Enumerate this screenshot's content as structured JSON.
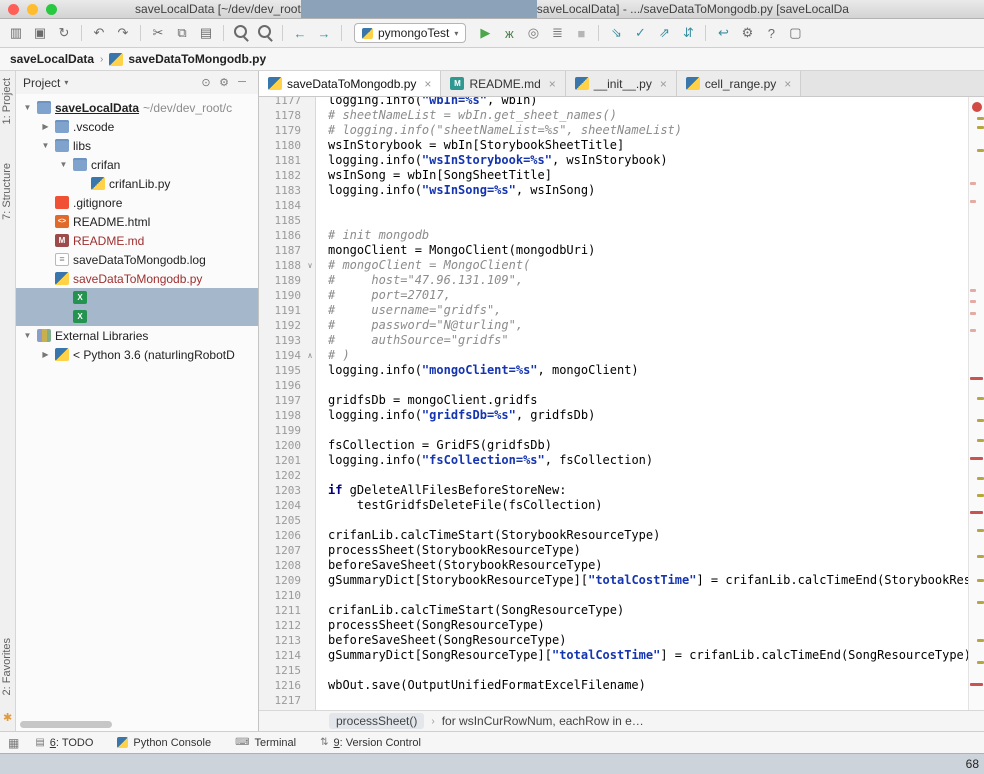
{
  "window": {
    "title_left": "saveLocalData [~/dev/dev_root",
    "title_right": "saveLocalData] - .../saveDataToMongodb.py [saveLocalDa"
  },
  "colors": {
    "selection": "#a4b7cb",
    "string": "#1434b0",
    "comment": "#8c8c8c",
    "keyword": "#000080",
    "error": "#c75450",
    "warning": "#b5a642",
    "typo": "#e5aaa2",
    "run_green": "#4ca64c",
    "accent_teal": "#3d8ea0",
    "unversioned_red": "#9e2f2f"
  },
  "toolbar": {
    "run_config": "pymongoTest",
    "groups": [
      [
        {
          "name": "open-project-icon",
          "g": "▥"
        },
        {
          "name": "save-all-icon",
          "g": "▣"
        },
        {
          "name": "synchronize-icon",
          "g": "↻"
        }
      ],
      [
        {
          "name": "undo-icon",
          "g": "↶"
        },
        {
          "name": "redo-icon",
          "g": "↷"
        }
      ],
      [
        {
          "name": "cut-icon",
          "g": "✂"
        },
        {
          "name": "copy-icon",
          "g": "⧉"
        },
        {
          "name": "paste-icon",
          "g": "▤"
        }
      ],
      [
        {
          "name": "find-icon",
          "g": "",
          "cls": "mag"
        },
        {
          "name": "replace-icon",
          "g": "",
          "cls": "mag"
        }
      ],
      [
        {
          "name": "navigate-back-icon",
          "g": "←",
          "c": "#3d8ea0"
        },
        {
          "name": "navigate-forward-icon",
          "g": "→",
          "c": "#3d8ea0"
        }
      ],
      [
        {
          "type": "combo",
          "name": "run-config-select",
          "label": "pymongoTest"
        },
        {
          "name": "run-icon",
          "g": "▶",
          "c": "#4ca64c"
        },
        {
          "name": "debug-icon",
          "g": "ж",
          "c": "#4e7d4e"
        },
        {
          "name": "run-coverage-icon",
          "g": "◎",
          "c": "#777777"
        },
        {
          "name": "profiler-icon",
          "g": "≣",
          "c": "#777777"
        },
        {
          "name": "stop-icon",
          "g": "■",
          "c": "#b5b5b5"
        }
      ],
      [
        {
          "name": "vcs-update-icon",
          "g": "⇘",
          "c": "#3d8ea0"
        },
        {
          "name": "vcs-commit-icon",
          "g": "✓",
          "c": "#3d8ea0"
        },
        {
          "name": "vcs-push-icon",
          "g": "⇗",
          "c": "#3d8ea0"
        },
        {
          "name": "vcs-diff-icon",
          "g": "⇵",
          "c": "#3d8ea0"
        }
      ],
      [
        {
          "name": "revert-icon",
          "g": "↩",
          "c": "#3d8ea0"
        },
        {
          "name": "settings-icon",
          "g": "⚙"
        },
        {
          "name": "help-icon",
          "g": "?"
        },
        {
          "name": "monitor-icon",
          "g": "▢"
        }
      ]
    ]
  },
  "navbar": {
    "separator": "›",
    "crumbs": [
      {
        "label": "saveLocalData",
        "bold": true
      },
      {
        "label": "saveDataToMongodb.py",
        "icon": "python",
        "bold": true
      }
    ]
  },
  "tool_strips": {
    "left": [
      "1: Project",
      "7: Structure",
      "2: Favorites"
    ],
    "star_glyph": "✱"
  },
  "project": {
    "header": "Project",
    "header_chevron": "▾",
    "header_icons": [
      {
        "name": "locate-icon",
        "g": "⊙"
      },
      {
        "name": "gear-icon",
        "g": "⚙"
      },
      {
        "name": "hide-panel-icon",
        "g": "─"
      }
    ],
    "tree": [
      {
        "indent": 0,
        "arrow": "▼",
        "icon": "folder-root",
        "label": "saveLocalData",
        "suffix": " ~/dev/dev_root/c",
        "bold": true,
        "underline": true
      },
      {
        "indent": 1,
        "arrow": "▶",
        "icon": "folder",
        "label": ".vscode"
      },
      {
        "indent": 1,
        "arrow": "▼",
        "icon": "folder",
        "label": "libs"
      },
      {
        "indent": 2,
        "arrow": "▼",
        "icon": "folder",
        "label": "crifan"
      },
      {
        "indent": 3,
        "arrow": "",
        "icon": "python",
        "label": "crifanLib.py"
      },
      {
        "indent": 1,
        "arrow": "",
        "icon": "git",
        "label": ".gitignore"
      },
      {
        "indent": 1,
        "arrow": "",
        "icon": "html",
        "label": "README.html",
        "badge": "<>"
      },
      {
        "indent": 1,
        "arrow": "",
        "icon": "md",
        "label": "README.md",
        "color": "red",
        "badge": "M"
      },
      {
        "indent": 1,
        "arrow": "",
        "icon": "log",
        "label": "saveDataToMongodb.log",
        "badge": "≡"
      },
      {
        "indent": 1,
        "arrow": "",
        "icon": "python",
        "label": "saveDataToMongodb.py",
        "color": "red"
      },
      {
        "indent": 2,
        "arrow": "",
        "icon": "excel",
        "label": "",
        "badge": "X",
        "selected": true
      },
      {
        "indent": 2,
        "arrow": "",
        "icon": "excel",
        "label": "",
        "badge": "X",
        "selected": true
      },
      {
        "indent": 0,
        "arrow": "▼",
        "icon": "lib",
        "label": "External Libraries"
      },
      {
        "indent": 1,
        "arrow": "▶",
        "icon": "python",
        "label": "< Python 3.6 (naturlingRobotD"
      }
    ]
  },
  "tabs": {
    "items": [
      {
        "label": "saveDataToMongodb.py",
        "icon": "python",
        "active": true,
        "close": "×"
      },
      {
        "label": "README.md",
        "icon": "mdteal",
        "badge": "M",
        "active": false,
        "close": "×"
      },
      {
        "label": "__init__.py",
        "icon": "python",
        "active": false,
        "close": "×"
      },
      {
        "label": "cell_range.py",
        "icon": "python",
        "active": false,
        "close": "×"
      }
    ]
  },
  "editor": {
    "breadcrumbs": [
      "processSheet()",
      "for wsInCurRowNum, eachRow in e…"
    ],
    "breadcrumb_separator": "›",
    "lines": [
      {
        "n": 1177,
        "seg": [
          [
            "p",
            "logging.info("
          ],
          [
            "s",
            "\"wbIn=%s\""
          ],
          [
            "p",
            ", wbIn)"
          ]
        ]
      },
      {
        "n": 1178,
        "seg": [
          [
            "c",
            "# sheetNameList = wbIn.get_sheet_names()"
          ]
        ]
      },
      {
        "n": 1179,
        "seg": [
          [
            "c",
            "# logging.info(\"sheetNameList=%s\", sheetNameList)"
          ]
        ]
      },
      {
        "n": 1180,
        "seg": [
          [
            "p",
            "wsInStorybook = wbIn[StorybookSheetTitle]"
          ]
        ]
      },
      {
        "n": 1181,
        "seg": [
          [
            "p",
            "logging.info("
          ],
          [
            "s",
            "\"wsInStorybook=%s\""
          ],
          [
            "p",
            ", wsInStorybook)"
          ]
        ]
      },
      {
        "n": 1182,
        "seg": [
          [
            "p",
            "wsInSong = wbIn[SongSheetTitle]"
          ]
        ]
      },
      {
        "n": 1183,
        "seg": [
          [
            "p",
            "logging.info("
          ],
          [
            "s",
            "\"wsInSong=%s\""
          ],
          [
            "p",
            ", wsInSong)"
          ]
        ]
      },
      {
        "n": 1184,
        "seg": []
      },
      {
        "n": 1185,
        "seg": []
      },
      {
        "n": 1186,
        "seg": [
          [
            "c",
            "# init mongodb"
          ]
        ]
      },
      {
        "n": 1187,
        "seg": [
          [
            "p",
            "mongoClient = MongoClient(mongodbUri)"
          ]
        ]
      },
      {
        "n": 1188,
        "seg": [
          [
            "c",
            "# mongoClient = MongoClient("
          ]
        ],
        "fold": "∨"
      },
      {
        "n": 1189,
        "seg": [
          [
            "c",
            "#     host=\"47.96.131.109\","
          ]
        ]
      },
      {
        "n": 1190,
        "seg": [
          [
            "c",
            "#     port=27017,"
          ]
        ]
      },
      {
        "n": 1191,
        "seg": [
          [
            "c",
            "#     username=\"gridfs\","
          ]
        ]
      },
      {
        "n": 1192,
        "seg": [
          [
            "c",
            "#     password=\"N@turling\","
          ]
        ]
      },
      {
        "n": 1193,
        "seg": [
          [
            "c",
            "#     authSource=\"gridfs\""
          ]
        ]
      },
      {
        "n": 1194,
        "seg": [
          [
            "c",
            "# )"
          ]
        ],
        "fold": "∧"
      },
      {
        "n": 1195,
        "seg": [
          [
            "p",
            "logging.info("
          ],
          [
            "s",
            "\"mongoClient=%s\""
          ],
          [
            "p",
            ", mongoClient)"
          ]
        ]
      },
      {
        "n": 1196,
        "seg": []
      },
      {
        "n": 1197,
        "seg": [
          [
            "p",
            "gridfsDb = mongoClient.gridfs"
          ]
        ]
      },
      {
        "n": 1198,
        "seg": [
          [
            "p",
            "logging.info("
          ],
          [
            "s",
            "\"gridfsDb=%s\""
          ],
          [
            "p",
            ", gridfsDb)"
          ]
        ]
      },
      {
        "n": 1199,
        "seg": []
      },
      {
        "n": 1200,
        "seg": [
          [
            "p",
            "fsCollection = GridFS(gridfsDb)"
          ]
        ]
      },
      {
        "n": 1201,
        "seg": [
          [
            "p",
            "logging.info("
          ],
          [
            "s",
            "\"fsCollection=%s\""
          ],
          [
            "p",
            ", fsCollection)"
          ]
        ]
      },
      {
        "n": 1202,
        "seg": []
      },
      {
        "n": 1203,
        "seg": [
          [
            "k",
            "if"
          ],
          [
            "p",
            " gDeleteAllFilesBeforeStoreNew:"
          ]
        ]
      },
      {
        "n": 1204,
        "seg": [
          [
            "p",
            "    testGridfsDeleteFile(fsCollection)"
          ]
        ]
      },
      {
        "n": 1205,
        "seg": []
      },
      {
        "n": 1206,
        "seg": [
          [
            "p",
            "crifanLib.calcTimeStart(StorybookResourceType)"
          ]
        ]
      },
      {
        "n": 1207,
        "seg": [
          [
            "p",
            "processSheet(StorybookResourceType)"
          ]
        ]
      },
      {
        "n": 1208,
        "seg": [
          [
            "p",
            "beforeSaveSheet(StorybookResourceType)"
          ]
        ]
      },
      {
        "n": 1209,
        "seg": [
          [
            "p",
            "gSummaryDict[StorybookResourceType]["
          ],
          [
            "s",
            "\"totalCostTime\""
          ],
          [
            "p",
            "] = crifanLib.calcTimeEnd(StorybookResour"
          ]
        ]
      },
      {
        "n": 1210,
        "seg": []
      },
      {
        "n": 1211,
        "seg": [
          [
            "p",
            "crifanLib.calcTimeStart(SongResourceType)"
          ]
        ]
      },
      {
        "n": 1212,
        "seg": [
          [
            "p",
            "processSheet(SongResourceType)"
          ]
        ]
      },
      {
        "n": 1213,
        "seg": [
          [
            "p",
            "beforeSaveSheet(SongResourceType)"
          ]
        ]
      },
      {
        "n": 1214,
        "seg": [
          [
            "p",
            "gSummaryDict[SongResourceType]["
          ],
          [
            "s",
            "\"totalCostTime\""
          ],
          [
            "p",
            "] = crifanLib.calcTimeEnd(SongResourceType)"
          ]
        ]
      },
      {
        "n": 1215,
        "seg": []
      },
      {
        "n": 1216,
        "seg": [
          [
            "p",
            "wbOut.save(OutputUnifiedFormatExcelFilename)"
          ]
        ]
      },
      {
        "n": 1217,
        "seg": []
      }
    ],
    "stripe_marks": [
      {
        "t": 20,
        "c": "o"
      },
      {
        "t": 29,
        "c": "o"
      },
      {
        "t": 52,
        "c": "o"
      },
      {
        "t": 85,
        "c": "p"
      },
      {
        "t": 103,
        "c": "p"
      },
      {
        "t": 192,
        "c": "p"
      },
      {
        "t": 203,
        "c": "p"
      },
      {
        "t": 215,
        "c": "p"
      },
      {
        "t": 232,
        "c": "p"
      },
      {
        "t": 280,
        "c": "r"
      },
      {
        "t": 300,
        "c": "o"
      },
      {
        "t": 322,
        "c": "o"
      },
      {
        "t": 342,
        "c": "o"
      },
      {
        "t": 360,
        "c": "r"
      },
      {
        "t": 380,
        "c": "o"
      },
      {
        "t": 397,
        "c": "o"
      },
      {
        "t": 414,
        "c": "r"
      },
      {
        "t": 432,
        "c": "o"
      },
      {
        "t": 458,
        "c": "o"
      },
      {
        "t": 482,
        "c": "o"
      },
      {
        "t": 504,
        "c": "o"
      },
      {
        "t": 542,
        "c": "o"
      },
      {
        "t": 564,
        "c": "o"
      },
      {
        "t": 586,
        "c": "r"
      }
    ]
  },
  "statusbar": {
    "switcher_glyph": "▦",
    "items": [
      {
        "mn": "6",
        "sep": ": ",
        "label": "TODO",
        "g": "▤"
      },
      {
        "label": "Python Console",
        "py": true
      },
      {
        "label": "Terminal",
        "g": "⌨"
      },
      {
        "mn": "9",
        "sep": ": ",
        "label": "Version Control",
        "g": "⇅"
      }
    ]
  },
  "bottom_strip": {
    "text": "68"
  }
}
